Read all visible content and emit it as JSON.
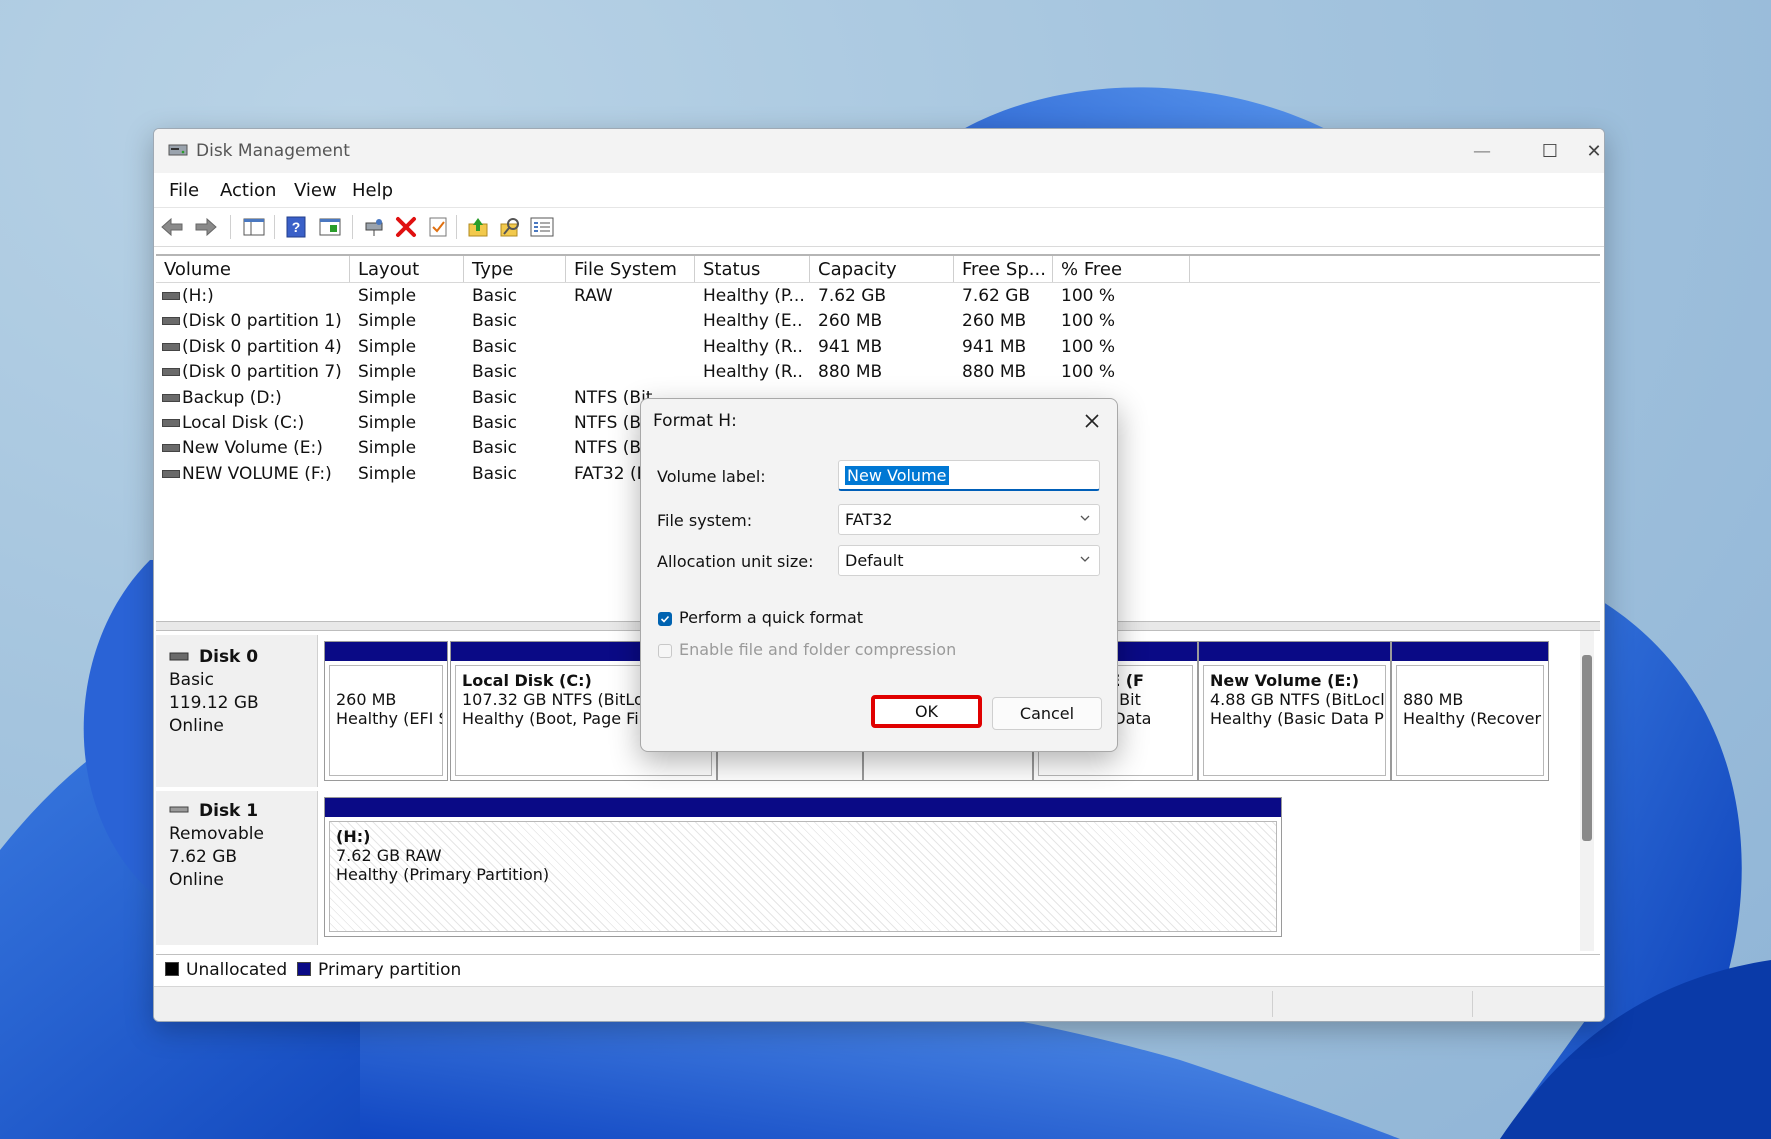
{
  "window": {
    "title": "Disk Management",
    "controls": {
      "minimize": "—",
      "maximize": "☐",
      "close": "✕"
    }
  },
  "menu": [
    "File",
    "Action",
    "View",
    "Help"
  ],
  "toolbar_icons": [
    "back-arrow-icon",
    "forward-arrow-icon",
    "console-tree-icon",
    "help-icon",
    "properties-icon",
    "connect-icon",
    "delete-icon",
    "checklist-icon",
    "upload-icon",
    "search-icon",
    "view-list-icon"
  ],
  "volume_table": {
    "columns": [
      "Volume",
      "Layout",
      "Type",
      "File System",
      "Status",
      "Capacity",
      "Free Sp...",
      "% Free"
    ],
    "rows": [
      [
        "(H:)",
        "Simple",
        "Basic",
        "RAW",
        "Healthy (P...",
        "7.62 GB",
        "7.62 GB",
        "100 %"
      ],
      [
        "(Disk 0 partition 1)",
        "Simple",
        "Basic",
        "",
        "Healthy (E...",
        "260 MB",
        "260 MB",
        "100 %"
      ],
      [
        "(Disk 0 partition 4)",
        "Simple",
        "Basic",
        "",
        "Healthy (R...",
        "941 MB",
        "941 MB",
        "100 %"
      ],
      [
        "(Disk 0 partition 7)",
        "Simple",
        "Basic",
        "",
        "Healthy (R...",
        "880 MB",
        "880 MB",
        "100 %"
      ],
      [
        "Backup (D:)",
        "Simple",
        "Basic",
        "NTFS (Bit",
        "",
        "",
        "",
        ""
      ],
      [
        "Local Disk (C:)",
        "Simple",
        "Basic",
        "NTFS (B",
        "",
        "",
        "",
        ""
      ],
      [
        "New Volume (E:)",
        "Simple",
        "Basic",
        "NTFS (B",
        "",
        "",
        "",
        ""
      ],
      [
        "NEW VOLUME (F:)",
        "Simple",
        "Basic",
        "FAT32 (E",
        "",
        "",
        "",
        ""
      ]
    ]
  },
  "disks": [
    {
      "name": "Disk 0",
      "type": "Basic",
      "size": "119.12 GB",
      "state": "Online",
      "partitions": [
        {
          "name": "",
          "line1": "260 MB",
          "line2": "Healthy (EFI S"
        },
        {
          "name": "Local Disk  (C:)",
          "line1": "107.32 GB NTFS (BitLoc",
          "line2": "Healthy (Boot, Page Fil"
        },
        {
          "name": "VOLUME  (F",
          "line1": "3 FAT32 (Bit",
          "line2": "y (Basic Data"
        },
        {
          "name": "New Volume  (E:)",
          "line1": "4.88 GB NTFS (BitLocl",
          "line2": "Healthy (Basic Data P"
        },
        {
          "name": "",
          "line1": "880 MB",
          "line2": "Healthy (Recover"
        }
      ]
    },
    {
      "name": "Disk 1",
      "type": "Removable",
      "size": "7.62 GB",
      "state": "Online",
      "partitions": [
        {
          "name": "(H:)",
          "line1": "7.62 GB RAW",
          "line2": "Healthy (Primary Partition)"
        }
      ]
    }
  ],
  "legend": [
    {
      "label": "Unallocated",
      "color": "#000000"
    },
    {
      "label": "Primary partition",
      "color": "#0a0a86"
    }
  ],
  "dialog": {
    "title": "Format H:",
    "volume_label": {
      "label": "Volume label:",
      "value": "New Volume"
    },
    "file_system": {
      "label": "File system:",
      "value": "FAT32"
    },
    "allocation": {
      "label": "Allocation unit size:",
      "value": "Default"
    },
    "quick_format": {
      "label": "Perform a quick format",
      "checked": true
    },
    "compression": {
      "label": "Enable file and folder compression",
      "checked": false,
      "enabled": false
    },
    "ok_label": "OK",
    "cancel_label": "Cancel",
    "highlight_color": "#e00000"
  }
}
